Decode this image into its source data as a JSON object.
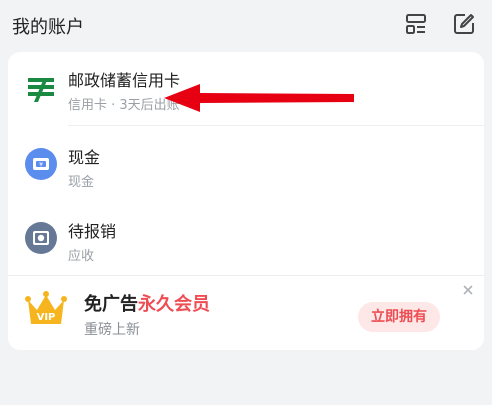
{
  "header": {
    "title": "我的账户",
    "icons": [
      "layout-icon",
      "edit-icon"
    ]
  },
  "accounts": [
    {
      "name": "邮政储蓄信用卡",
      "sub": "信用卡 · 3天后出账",
      "icon": "postal-bank-icon"
    },
    {
      "name": "现金",
      "sub": "现金",
      "icon": "cash-icon"
    },
    {
      "name": "待报销",
      "sub": "应收",
      "icon": "reimburse-icon"
    }
  ],
  "promo": {
    "title_prefix": "免广告",
    "title_highlight": "永久会员",
    "subtitle": "重磅上新",
    "cta": "立即拥有",
    "icon": "vip-crown-icon"
  },
  "annotation": {
    "type": "red-arrow"
  },
  "colors": {
    "background": "#f2f3f5",
    "card": "#ffffff",
    "accent_red": "#ee4d54",
    "postal_green": "#1a8a43",
    "cash_blue": "#5b8def",
    "reimburse_gray": "#667896",
    "crown_gold": "#f6b51e"
  }
}
